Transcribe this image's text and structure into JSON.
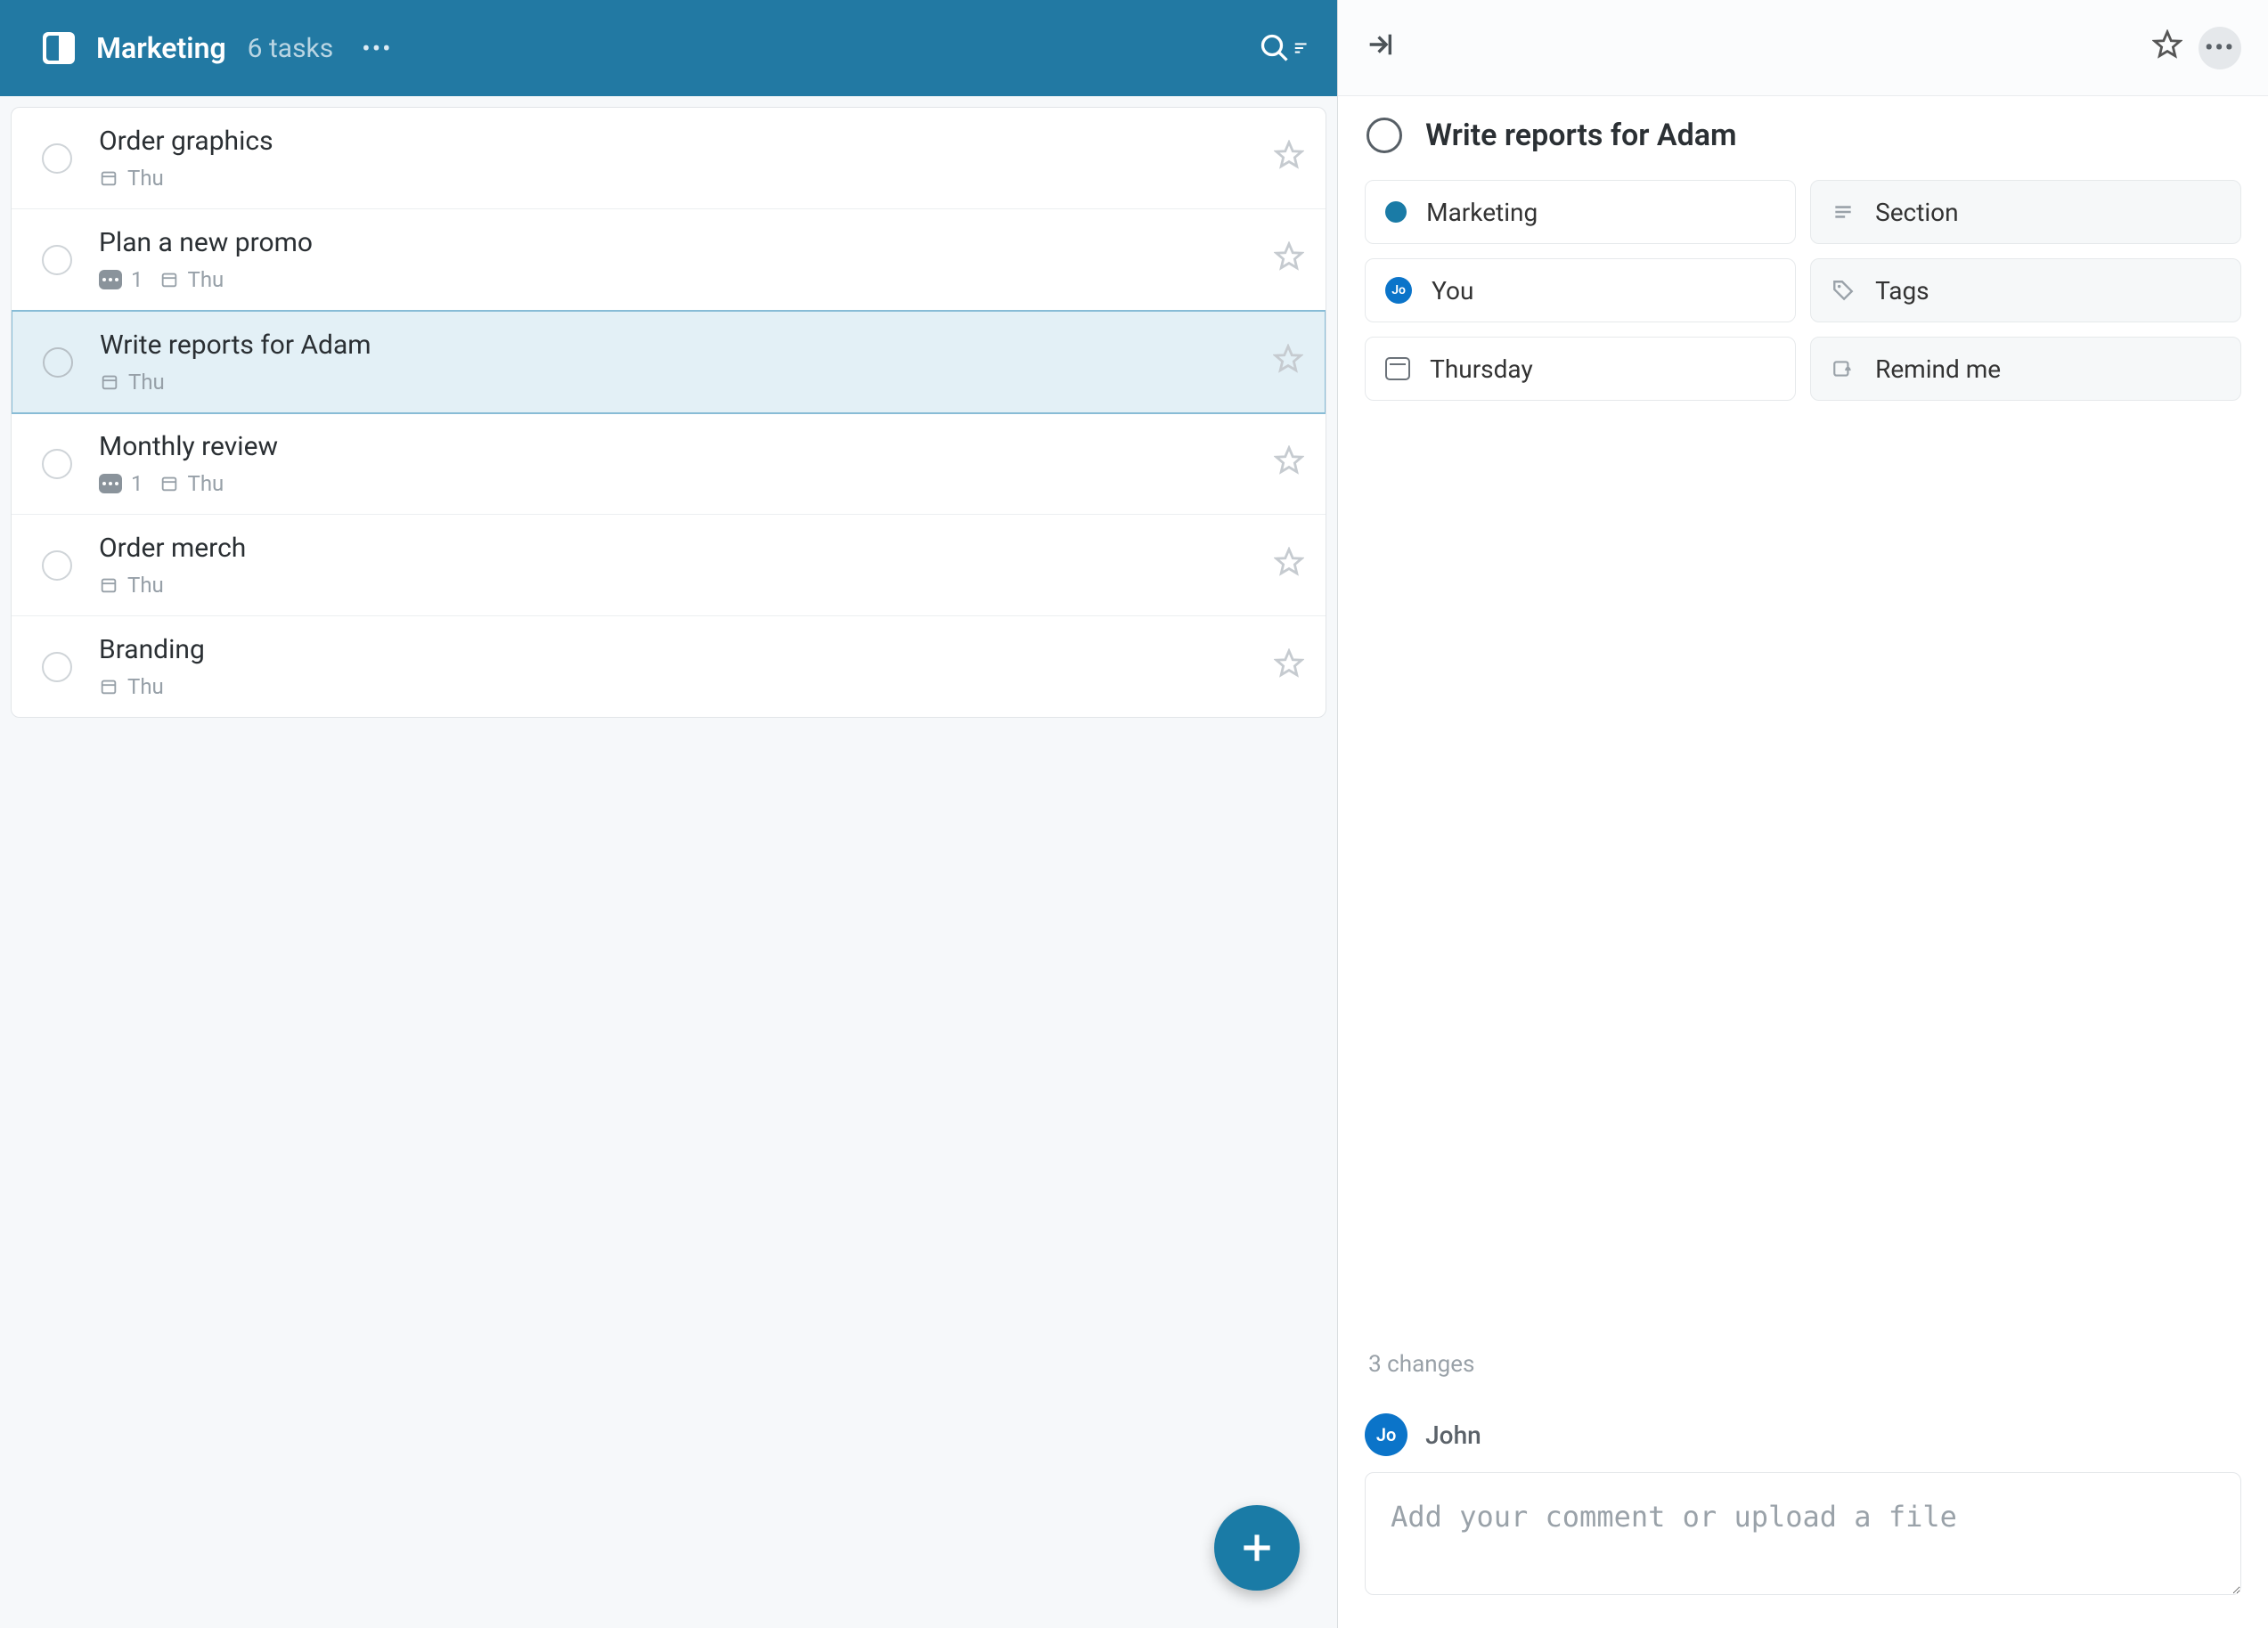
{
  "header": {
    "title": "Marketing",
    "task_count_label": "6 tasks"
  },
  "tasks": [
    {
      "title": "Order graphics",
      "date": "Thu",
      "comments": null,
      "selected": false
    },
    {
      "title": "Plan a new promo",
      "date": "Thu",
      "comments": "1",
      "selected": false
    },
    {
      "title": "Write reports for Adam",
      "date": "Thu",
      "comments": null,
      "selected": true
    },
    {
      "title": "Monthly review",
      "date": "Thu",
      "comments": "1",
      "selected": false
    },
    {
      "title": "Order merch",
      "date": "Thu",
      "comments": null,
      "selected": false
    },
    {
      "title": "Branding",
      "date": "Thu",
      "comments": null,
      "selected": false
    }
  ],
  "detail": {
    "title": "Write reports for Adam",
    "project": "Marketing",
    "section_placeholder": "Section",
    "assignee": "You",
    "assignee_initials": "Jo",
    "tags_placeholder": "Tags",
    "date": "Thursday",
    "remind_placeholder": "Remind me",
    "changes_label": "3 changes"
  },
  "comment": {
    "author_initials": "Jo",
    "author_name": "John",
    "placeholder": "Add your comment or upload a file"
  }
}
